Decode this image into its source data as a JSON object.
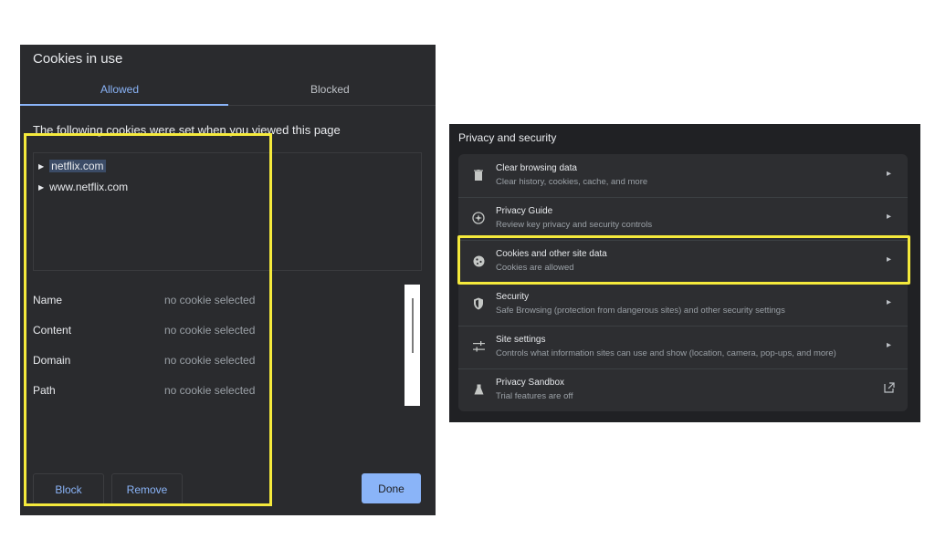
{
  "dialog": {
    "title": "Cookies in use",
    "tabs": {
      "allowed": "Allowed",
      "blocked": "Blocked"
    },
    "intro": "The following cookies were set when you viewed this page",
    "tree": [
      {
        "label": "netflix.com",
        "icon": "triangle-right-icon"
      },
      {
        "label": "www.netflix.com",
        "icon": "triangle-right-icon"
      }
    ],
    "details": [
      {
        "label": "Name",
        "value": "no cookie selected"
      },
      {
        "label": "Content",
        "value": "no cookie selected"
      },
      {
        "label": "Domain",
        "value": "no cookie selected"
      },
      {
        "label": "Path",
        "value": "no cookie selected"
      }
    ],
    "buttons": {
      "block": "Block",
      "remove": "Remove",
      "done": "Done"
    }
  },
  "settings": {
    "title": "Privacy and security",
    "items": [
      {
        "title": "Clear browsing data",
        "subtitle": "Clear history, cookies, cache, and more",
        "icon": "trash-icon"
      },
      {
        "title": "Privacy Guide",
        "subtitle": "Review key privacy and security controls",
        "icon": "compass-icon"
      },
      {
        "title": "Cookies and other site data",
        "subtitle": "Cookies are allowed",
        "icon": "cookie-icon"
      },
      {
        "title": "Security",
        "subtitle": "Safe Browsing (protection from dangerous sites) and other security settings",
        "icon": "shield-icon"
      },
      {
        "title": "Site settings",
        "subtitle": "Controls what information sites can use and show (location, camera, pop-ups, and more)",
        "icon": "sliders-icon"
      },
      {
        "title": "Privacy Sandbox",
        "subtitle": "Trial features are off",
        "icon": "flask-icon"
      }
    ]
  },
  "colors": {
    "accent": "#8ab4f8",
    "highlight": "#f5ea3c",
    "dialog_bg": "#2a2b2e",
    "panel_bg": "#202124"
  }
}
